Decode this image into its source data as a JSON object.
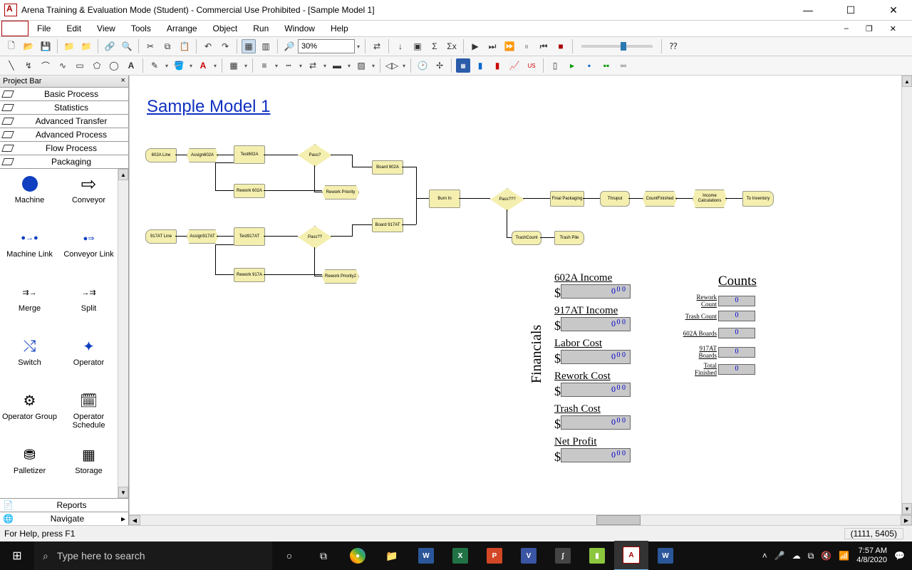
{
  "title": "Arena Training & Evaluation Mode (Student) - Commercial Use Prohibited - [Sample Model 1]",
  "menu": {
    "file": "File",
    "edit": "Edit",
    "view": "View",
    "tools": "Tools",
    "arrange": "Arrange",
    "object": "Object",
    "run": "Run",
    "window": "Window",
    "help": "Help"
  },
  "zoom": "30%",
  "projectbar": {
    "title": "Project Bar",
    "cats": [
      "Basic Process",
      "Statistics",
      "Advanced Transfer",
      "Advanced Process",
      "Flow Process",
      "Packaging"
    ],
    "items": [
      "Machine",
      "Conveyor",
      "Machine Link",
      "Conveyor Link",
      "Merge",
      "Split",
      "Switch",
      "Operator",
      "Operator Group",
      "Operator Schedule",
      "Palletizer",
      "Storage"
    ],
    "foot": {
      "reports": "Reports",
      "navigate": "Navigate"
    }
  },
  "model": {
    "title": "Sample Model 1",
    "shapes": {
      "l602": "602A Line",
      "a602": "Assign602A",
      "t602": "Test602A",
      "pass1": "Pass?",
      "b602": "Board 602A",
      "rw602": "Rework 602A",
      "rwp": "Rework Priority",
      "l917": "917AT Line",
      "a917": "Assign917AT",
      "t917": "Test917AT",
      "pass2": "Pass??",
      "b917": "Board 917AT",
      "rw917": "Rework 917A",
      "rwp2": "Rework Priority2",
      "burn": "Burn In",
      "pass3": "Pass???",
      "pkg": "Final Packaging",
      "thru": "Thruput",
      "fin": "CountFinished",
      "inc": "Income Calculations",
      "inv": "To Inventory",
      "tc": "TrashCount",
      "tp": "Trash Pile"
    }
  },
  "fin": {
    "heading": "Financials",
    "rows": [
      {
        "label": "602A Income"
      },
      {
        "label": "917AT Income"
      },
      {
        "label": "Labor Cost"
      },
      {
        "label": "Rework Cost"
      },
      {
        "label": "Trash Cost"
      },
      {
        "label": "Net Profit"
      }
    ],
    "digits": {
      "v": "0",
      "d": "0 0"
    }
  },
  "counts": {
    "heading": "Counts",
    "rows": [
      {
        "label": "Rework Count",
        "v": "0"
      },
      {
        "label": "Trash Count",
        "v": "0"
      },
      {
        "label": "602A Boards",
        "v": "0"
      },
      {
        "label": "917AT Boards",
        "v": "0"
      },
      {
        "label": "Total Finished",
        "v": "0"
      }
    ]
  },
  "status": {
    "help": "For Help, press F1",
    "coords": "(1111, 5405)"
  },
  "taskbar": {
    "search": "Type here to search",
    "time": "7:57 AM",
    "date": "4/8/2020"
  }
}
